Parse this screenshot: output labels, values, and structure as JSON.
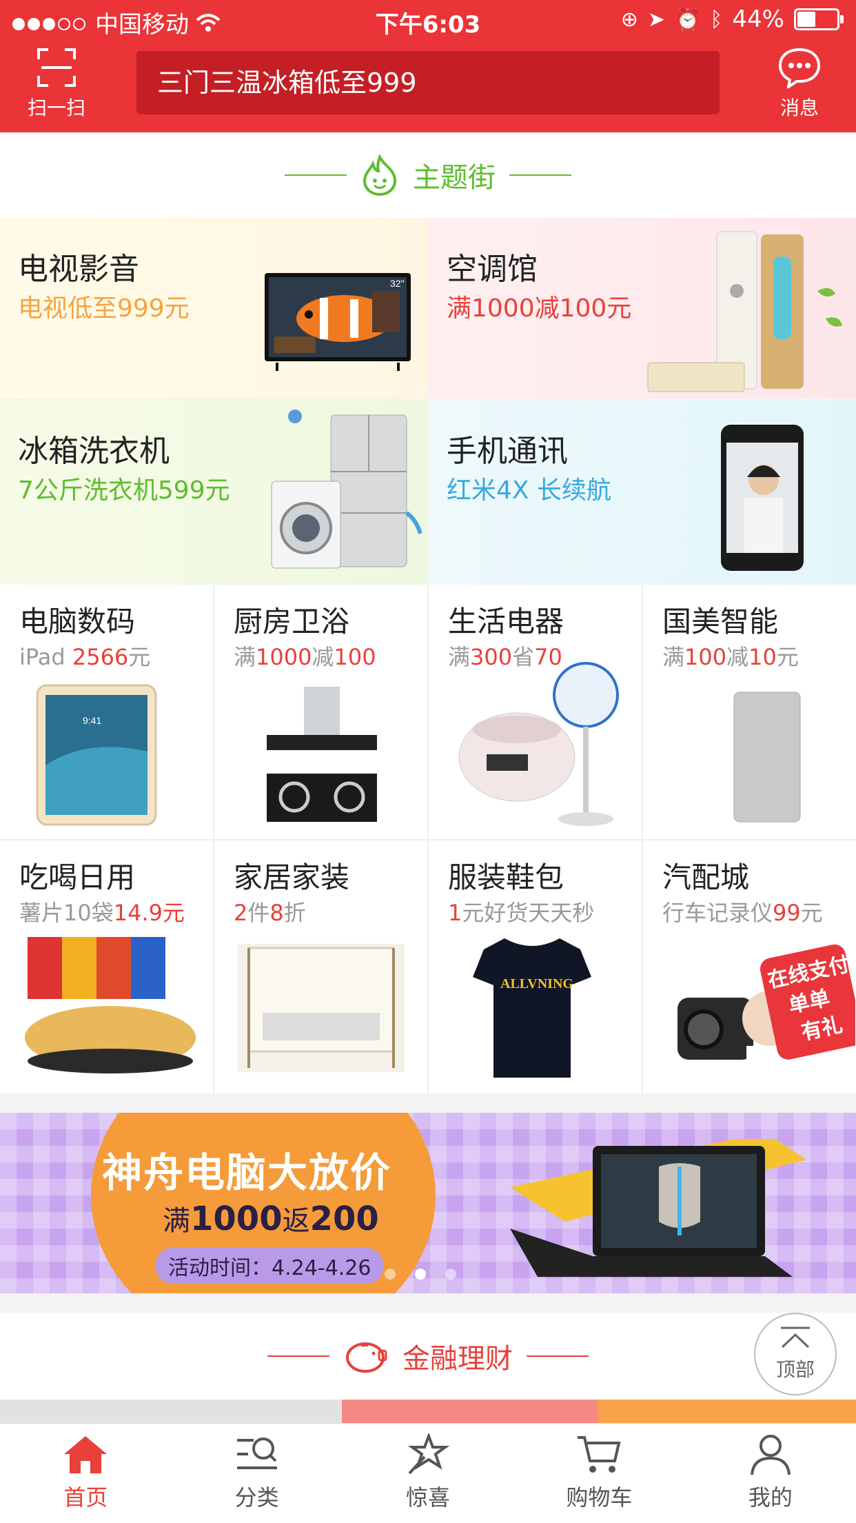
{
  "status_bar": {
    "carrier": "中国移动",
    "time": "下午6:03",
    "battery": "44%"
  },
  "header": {
    "scan_label": "扫一扫",
    "search_placeholder": "三门三温冰箱低至999",
    "message_label": "消息"
  },
  "theme_street": {
    "title": "主题街",
    "tiles": [
      {
        "title": "电视影音",
        "subtitle": "电视低至999元",
        "tv_badge": "32\""
      },
      {
        "title": "空调馆",
        "subtitle": "满1000减100元"
      },
      {
        "title": "冰箱洗衣机",
        "subtitle": "7公斤洗衣机599元"
      },
      {
        "title": "手机通讯",
        "subtitle": "红米4X 长续航"
      }
    ]
  },
  "categories": [
    {
      "title": "电脑数码",
      "sub": [
        {
          "t": "iPad ",
          "r": false
        },
        {
          "t": "2566",
          "r": true
        },
        {
          "t": "元",
          "r": false
        }
      ]
    },
    {
      "title": "厨房卫浴",
      "sub": [
        {
          "t": "满",
          "r": false
        },
        {
          "t": "1000",
          "r": true
        },
        {
          "t": "减",
          "r": false
        },
        {
          "t": "100",
          "r": true
        }
      ]
    },
    {
      "title": "生活电器",
      "sub": [
        {
          "t": "满",
          "r": false
        },
        {
          "t": "300",
          "r": true
        },
        {
          "t": "省",
          "r": false
        },
        {
          "t": "70",
          "r": true
        }
      ]
    },
    {
      "title": "国美智能",
      "sub": [
        {
          "t": "满",
          "r": false
        },
        {
          "t": "100",
          "r": true
        },
        {
          "t": "减",
          "r": false
        },
        {
          "t": "10",
          "r": true
        },
        {
          "t": "元",
          "r": false
        }
      ]
    },
    {
      "title": "吃喝日用",
      "sub": [
        {
          "t": "薯片10袋",
          "r": false
        },
        {
          "t": "14.9元",
          "r": true
        }
      ]
    },
    {
      "title": "家居家装",
      "sub": [
        {
          "t": "2",
          "r": true
        },
        {
          "t": "件",
          "r": false
        },
        {
          "t": "8",
          "r": true
        },
        {
          "t": "折",
          "r": false
        }
      ]
    },
    {
      "title": "服装鞋包",
      "sub": [
        {
          "t": "1",
          "r": true
        },
        {
          "t": "元好货天天秒",
          "r": false
        }
      ]
    },
    {
      "title": "汽配城",
      "sub": [
        {
          "t": "行车记录仪",
          "r": false
        },
        {
          "t": "99",
          "r": true
        },
        {
          "t": "元",
          "r": false
        }
      ]
    }
  ],
  "product_text": {
    "shirt_print": "ALLVNING",
    "dashcam_badge_1": "在线支付",
    "dashcam_badge_2": "单单",
    "dashcam_badge_3": "有礼"
  },
  "banner": {
    "title": "神舟电脑大放价",
    "offer_prefix": "满",
    "offer_a": "1000",
    "offer_mid": "返",
    "offer_b": "200",
    "period": "活动时间：4.24-4.26",
    "active_dot": 1,
    "dot_count": 3
  },
  "finance": {
    "title": "金融理财"
  },
  "back_to_top": {
    "label": "顶部"
  },
  "tabbar": {
    "items": [
      "首页",
      "分类",
      "惊喜",
      "购物车",
      "我的"
    ],
    "active": 0
  },
  "colors": {
    "brand_red": "#ea3438",
    "theme_green": "#5cbd2c",
    "finance_red": "#e8403a"
  }
}
